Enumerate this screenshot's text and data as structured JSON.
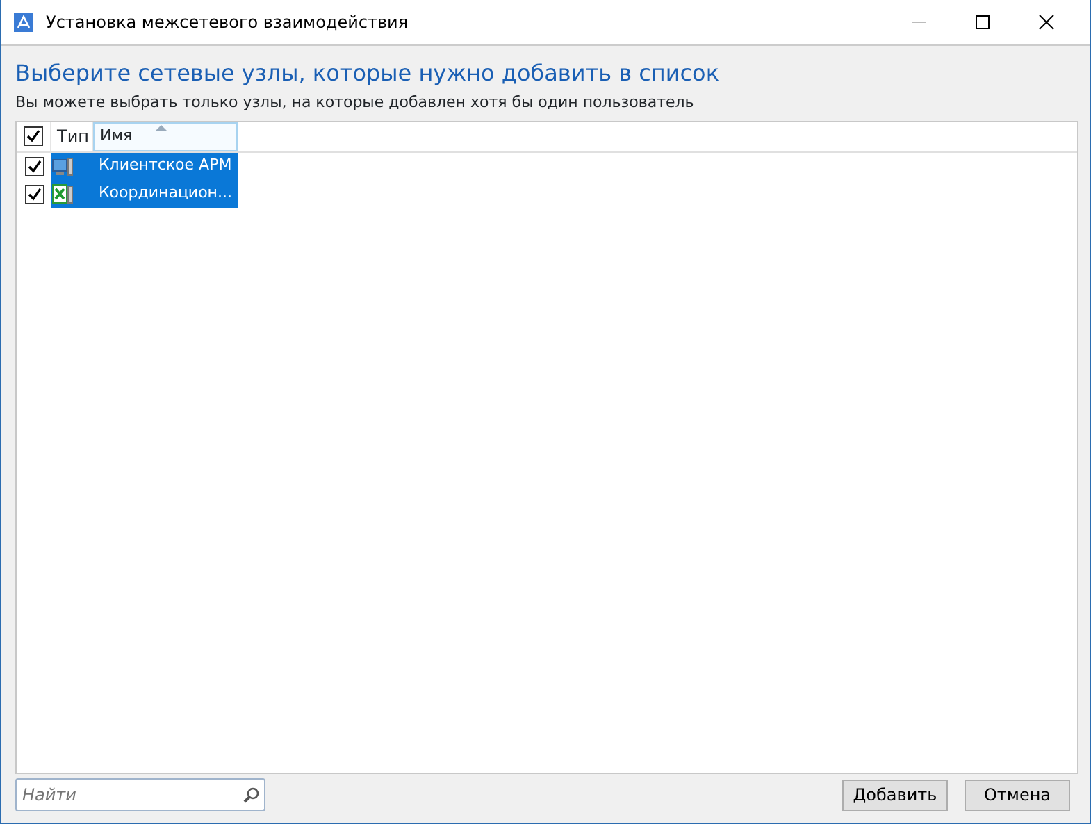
{
  "window": {
    "title": "Установка межсетевого взаимодействия"
  },
  "heading": "Выберите сетевые узлы, которые нужно добавить в список",
  "subheading": "Вы можете выбрать только узлы, на которые добавлен хотя бы один пользователь",
  "table": {
    "all_checked": true,
    "columns": [
      {
        "label": "Тип",
        "sorted": false
      },
      {
        "label": "Имя",
        "sorted": true
      }
    ],
    "rows": [
      {
        "checked": true,
        "selected": true,
        "kind": "client",
        "name": "Клиентское АРМ"
      },
      {
        "checked": true,
        "selected": true,
        "kind": "coordinator",
        "name": "Координацион..."
      }
    ]
  },
  "search": {
    "placeholder": "Найти"
  },
  "buttons": [
    "Добавить",
    "Отмена"
  ]
}
